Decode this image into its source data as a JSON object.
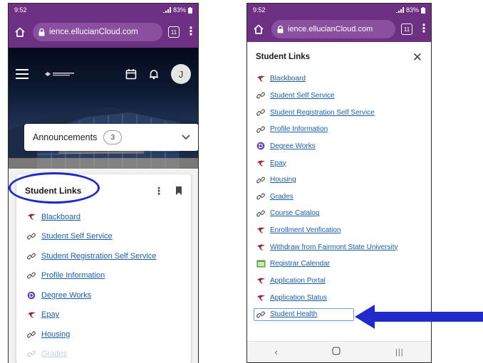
{
  "colors": {
    "browser_purple": "#6d3083",
    "link_blue": "#1a5fa8",
    "annotation_blue": "#1f2ac9"
  },
  "left_phone": {
    "status": {
      "time": "9:52",
      "battery": "83%"
    },
    "browser": {
      "url": "ience.ellucianCloud.com",
      "tab_count": "11"
    },
    "header": {
      "avatar_initial": "J"
    },
    "announcements": {
      "label": "Announcements",
      "count": "3"
    },
    "card": {
      "title": "Student Links",
      "items": [
        {
          "label": "Blackboard",
          "icon": "brand-icon"
        },
        {
          "label": "Student Self Service",
          "icon": "link-icon"
        },
        {
          "label": "Student Registration Self Service",
          "icon": "link-icon"
        },
        {
          "label": "Profile Information",
          "icon": "link-icon"
        },
        {
          "label": "Degree Works",
          "icon": "degree-works-icon"
        },
        {
          "label": "Epay",
          "icon": "brand-icon"
        },
        {
          "label": "Housing",
          "icon": "link-icon"
        },
        {
          "label": "Grades",
          "icon": "link-icon"
        }
      ]
    }
  },
  "right_phone": {
    "status": {
      "time": "9:52",
      "battery": "83%"
    },
    "browser": {
      "url": "ience.ellucianCloud.com",
      "tab_count": "11"
    },
    "panel": {
      "title": "Student Links",
      "items": [
        {
          "label": "Blackboard",
          "icon": "brand-icon"
        },
        {
          "label": "Student Self Service",
          "icon": "link-icon"
        },
        {
          "label": "Student Registration Self Service",
          "icon": "link-icon"
        },
        {
          "label": "Profile Information",
          "icon": "link-icon"
        },
        {
          "label": "Degree Works",
          "icon": "degree-works-icon"
        },
        {
          "label": "Epay",
          "icon": "brand-icon"
        },
        {
          "label": "Housing",
          "icon": "link-icon"
        },
        {
          "label": "Grades",
          "icon": "link-icon"
        },
        {
          "label": "Course Catalog",
          "icon": "link-icon"
        },
        {
          "label": "Enrollment Verification",
          "icon": "brand-icon"
        },
        {
          "label": "Withdraw from Fairmont State University",
          "icon": "brand-icon"
        },
        {
          "label": "Registrar Calendar",
          "icon": "calendar-image-icon"
        },
        {
          "label": "Application Portal",
          "icon": "brand-icon"
        },
        {
          "label": "Application Status",
          "icon": "brand-icon"
        },
        {
          "label": "Student Health",
          "icon": "link-icon"
        }
      ]
    }
  }
}
